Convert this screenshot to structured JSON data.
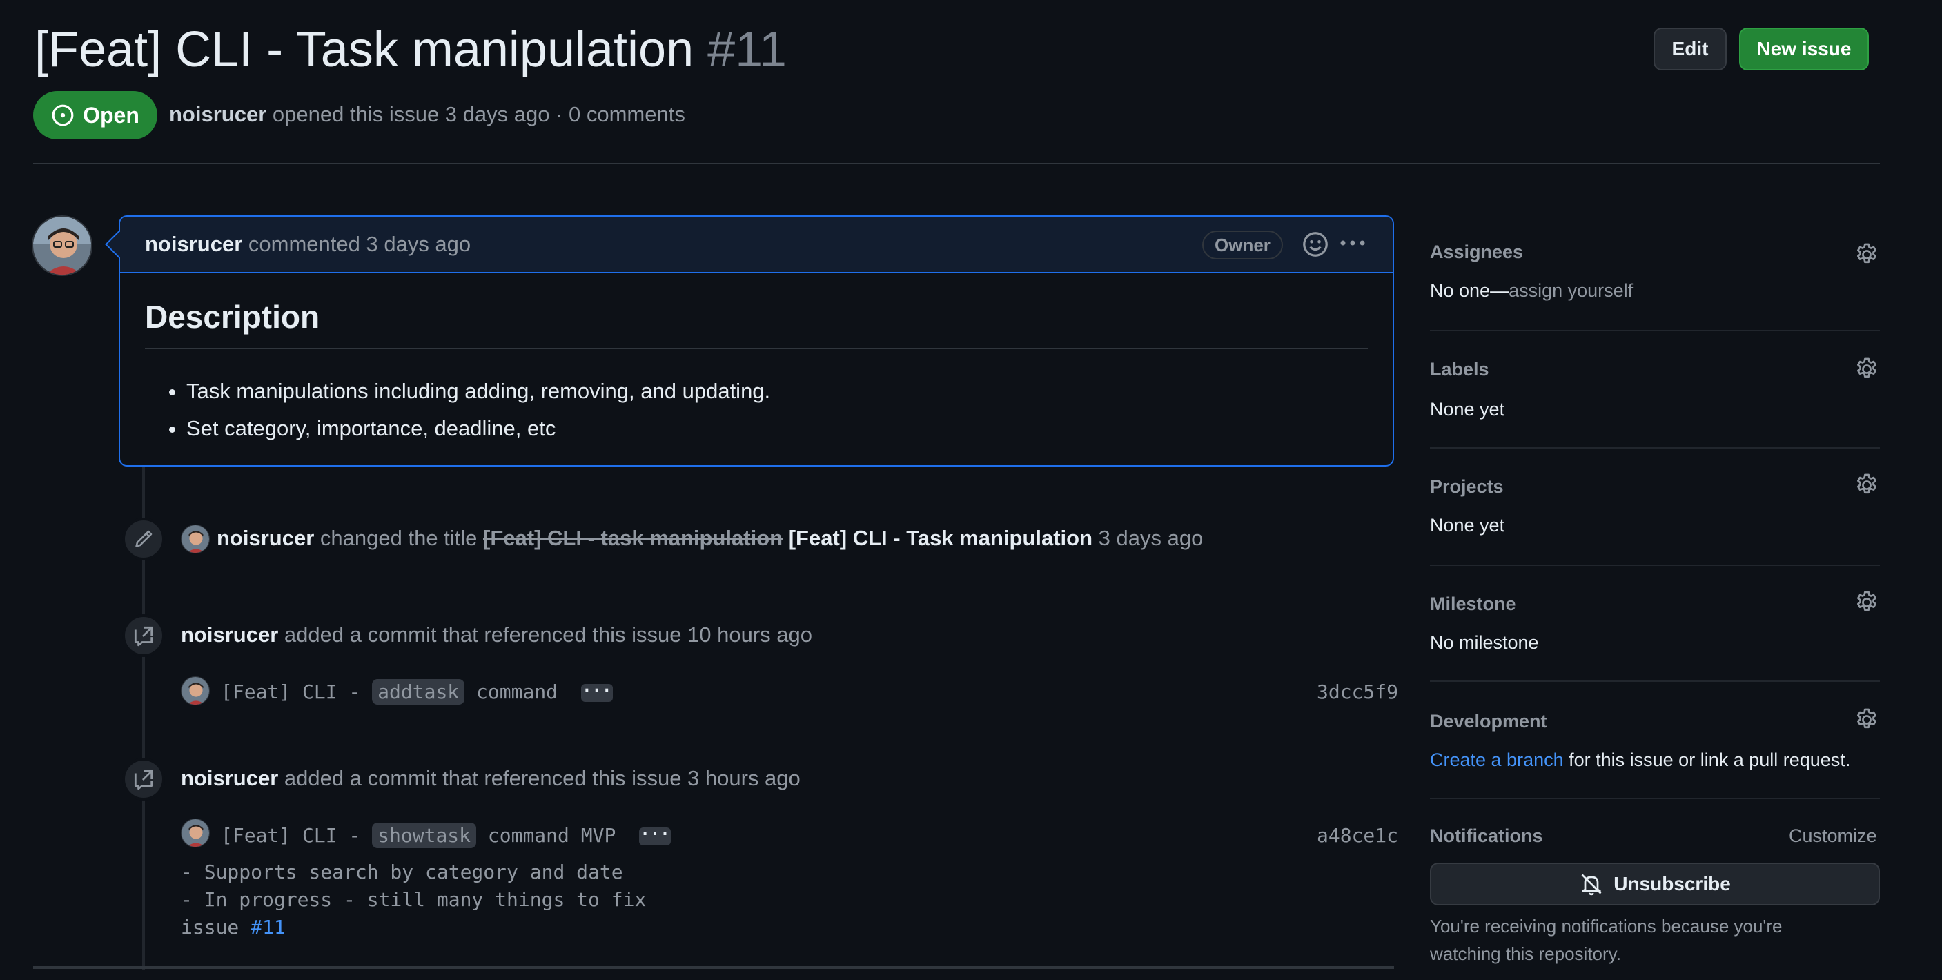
{
  "header": {
    "title": "[Feat] CLI - Task manipulation",
    "number": "#11",
    "edit_label": "Edit",
    "new_issue_label": "New issue",
    "status": "Open",
    "author": "noisrucer",
    "meta_text": "opened this issue 3 days ago · 0 comments"
  },
  "comment": {
    "author": "noisrucer",
    "action": "commented 3 days ago",
    "badge": "Owner",
    "heading": "Description",
    "bullets": [
      "Task manipulations including adding, removing, and updating.",
      "Set category, importance, deadline, etc"
    ]
  },
  "timeline": {
    "rename": {
      "author": "noisrucer",
      "action": "changed the title",
      "old_title": "[Feat] CLI - task manipulation",
      "new_title": "[Feat] CLI - Task manipulation",
      "time": "3 days ago"
    },
    "commit_ref_1": {
      "author": "noisrucer",
      "action": "added a commit that referenced this issue 10 hours ago",
      "commit_prefix": "[Feat] CLI -",
      "commit_code": "addtask",
      "commit_suffix": "command",
      "ellipsis": "···",
      "sha": "3dcc5f9"
    },
    "commit_ref_2": {
      "author": "noisrucer",
      "action": "added a commit that referenced this issue 3 hours ago",
      "commit_prefix": "[Feat] CLI -",
      "commit_code": "showtask",
      "commit_suffix": "command MVP",
      "ellipsis": "···",
      "sha": "a48ce1c",
      "body_line1": "- Supports search by category and date",
      "body_line2": "- In progress - still many things to fix",
      "body_line3_prefix": "issue ",
      "body_line3_link": "#11"
    }
  },
  "sidebar": {
    "assignees_label": "Assignees",
    "assignees_none": "No one—",
    "assignees_action": "assign yourself",
    "labels_label": "Labels",
    "labels_value": "None yet",
    "projects_label": "Projects",
    "projects_value": "None yet",
    "milestone_label": "Milestone",
    "milestone_value": "No milestone",
    "development_label": "Development",
    "development_link": "Create a branch",
    "development_text": " for this issue or link a pull request.",
    "notifications_label": "Notifications",
    "customize_label": "Customize",
    "unsubscribe_label": "Unsubscribe",
    "notifications_note": "You're receiving notifications because you're watching this repository."
  },
  "colors": {
    "background": "#0d1117",
    "open_green": "#238636",
    "link_blue": "#4493f8",
    "comment_border": "#1f6feb"
  },
  "icons": [
    "issue-open-icon",
    "smiley-icon",
    "kebab-icon",
    "pencil-icon",
    "cross-reference-icon",
    "gear-icon",
    "bell-slash-icon"
  ]
}
